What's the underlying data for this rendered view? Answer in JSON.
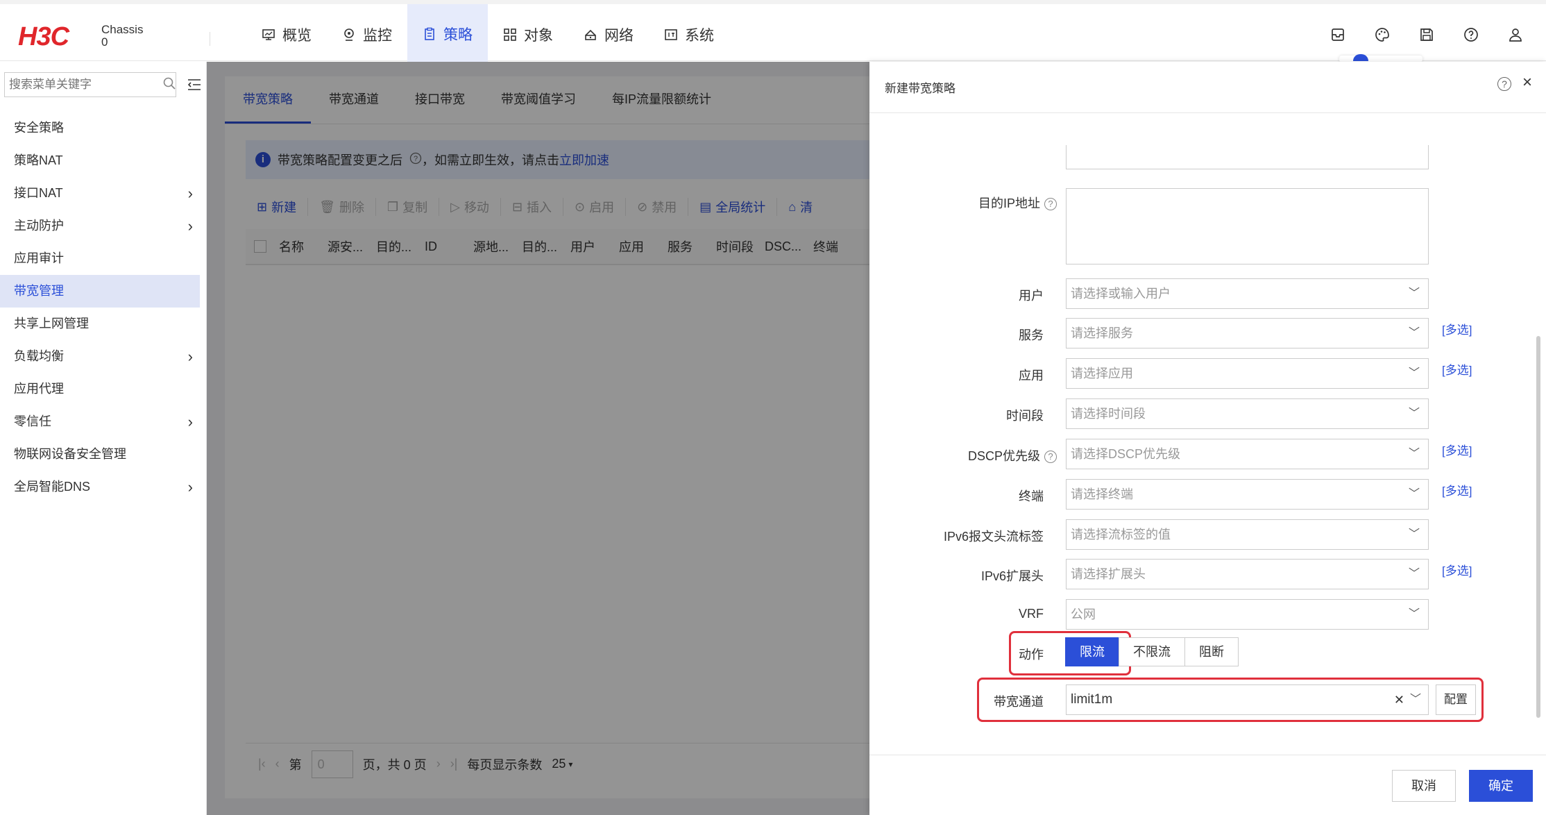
{
  "header": {
    "logo": "H3C",
    "chassis_label": "Chassis",
    "chassis_value": "0",
    "nav": [
      {
        "label": "概览",
        "icon": "monitor-icon"
      },
      {
        "label": "监控",
        "icon": "location-icon"
      },
      {
        "label": "策略",
        "icon": "clipboard-icon",
        "active": true
      },
      {
        "label": "对象",
        "icon": "grid-icon"
      },
      {
        "label": "网络",
        "icon": "network-icon"
      },
      {
        "label": "系统",
        "icon": "system-icon"
      }
    ],
    "icons": [
      "mailbox-icon",
      "palette-icon",
      "save-icon",
      "help-icon",
      "user-icon"
    ]
  },
  "sidebar": {
    "search_placeholder": "搜索菜单关键字",
    "items": [
      {
        "label": "安全策略",
        "chevron": false
      },
      {
        "label": "策略NAT",
        "chevron": false
      },
      {
        "label": "接口NAT",
        "chevron": true
      },
      {
        "label": "主动防护",
        "chevron": true
      },
      {
        "label": "应用审计",
        "chevron": false
      },
      {
        "label": "带宽管理",
        "chevron": false,
        "active": true
      },
      {
        "label": "共享上网管理",
        "chevron": false
      },
      {
        "label": "负载均衡",
        "chevron": true
      },
      {
        "label": "应用代理",
        "chevron": false
      },
      {
        "label": "零信任",
        "chevron": true
      },
      {
        "label": "物联网设备安全管理",
        "chevron": false
      },
      {
        "label": "全局智能DNS",
        "chevron": true
      }
    ]
  },
  "main": {
    "tabs": [
      "带宽策略",
      "带宽通道",
      "接口带宽",
      "带宽阈值学习",
      "每IP流量限额统计"
    ],
    "notice_text": "带宽策略配置变更之后",
    "notice_text2": "，如需立即生效，请点击",
    "notice_link": "立即加速",
    "toolbar": [
      {
        "label": "新建",
        "icon": "plus-icon",
        "enabled": true
      },
      {
        "label": "删除",
        "icon": "trash-icon",
        "enabled": false
      },
      {
        "label": "复制",
        "icon": "copy-icon",
        "enabled": false
      },
      {
        "label": "移动",
        "icon": "move-icon",
        "enabled": false
      },
      {
        "label": "插入",
        "icon": "insert-icon",
        "enabled": false
      },
      {
        "label": "启用",
        "icon": "play-icon",
        "enabled": false
      },
      {
        "label": "禁用",
        "icon": "ban-icon",
        "enabled": false
      },
      {
        "label": "全局统计",
        "icon": "stats-icon",
        "enabled": true
      },
      {
        "label": "清",
        "icon": "clear-icon",
        "enabled": true
      }
    ],
    "columns": [
      "名称",
      "源安...",
      "目的...",
      "ID",
      "源地...",
      "目的...",
      "用户",
      "应用",
      "服务",
      "时间段",
      "DSC...",
      "终端"
    ],
    "pager": {
      "page_prefix": "第",
      "page_value": "0",
      "page_suffix": "页，共 0 页",
      "per_page_label": "每页显示条数",
      "per_page_value": "25"
    }
  },
  "dialog": {
    "title": "新建带宽策略",
    "fields": {
      "dest_ip_label": "目的IP地址",
      "user_label": "用户",
      "user_placeholder": "请选择或输入用户",
      "service_label": "服务",
      "service_placeholder": "请选择服务",
      "app_label": "应用",
      "app_placeholder": "请选择应用",
      "time_label": "时间段",
      "time_placeholder": "请选择时间段",
      "dscp_label": "DSCP优先级",
      "dscp_placeholder": "请选择DSCP优先级",
      "terminal_label": "终端",
      "terminal_placeholder": "请选择终端",
      "ipv6_flow_label": "IPv6报文头流标签",
      "ipv6_flow_placeholder": "请选择流标签的值",
      "ipv6_ext_label": "IPv6扩展头",
      "ipv6_ext_placeholder": "请选择扩展头",
      "vrf_label": "VRF",
      "vrf_value": "公网",
      "action_label": "动作",
      "actions": [
        "限流",
        "不限流",
        "阻断"
      ],
      "active_action": "限流",
      "channel_label": "带宽通道",
      "channel_value": "limit1m",
      "config_button": "配置",
      "multi_select": "[多选]"
    },
    "cancel": "取消",
    "ok": "确定"
  },
  "colors": {
    "accent": "#2b4fd8",
    "highlight": "#e0303c",
    "brand": "#e0262b"
  }
}
